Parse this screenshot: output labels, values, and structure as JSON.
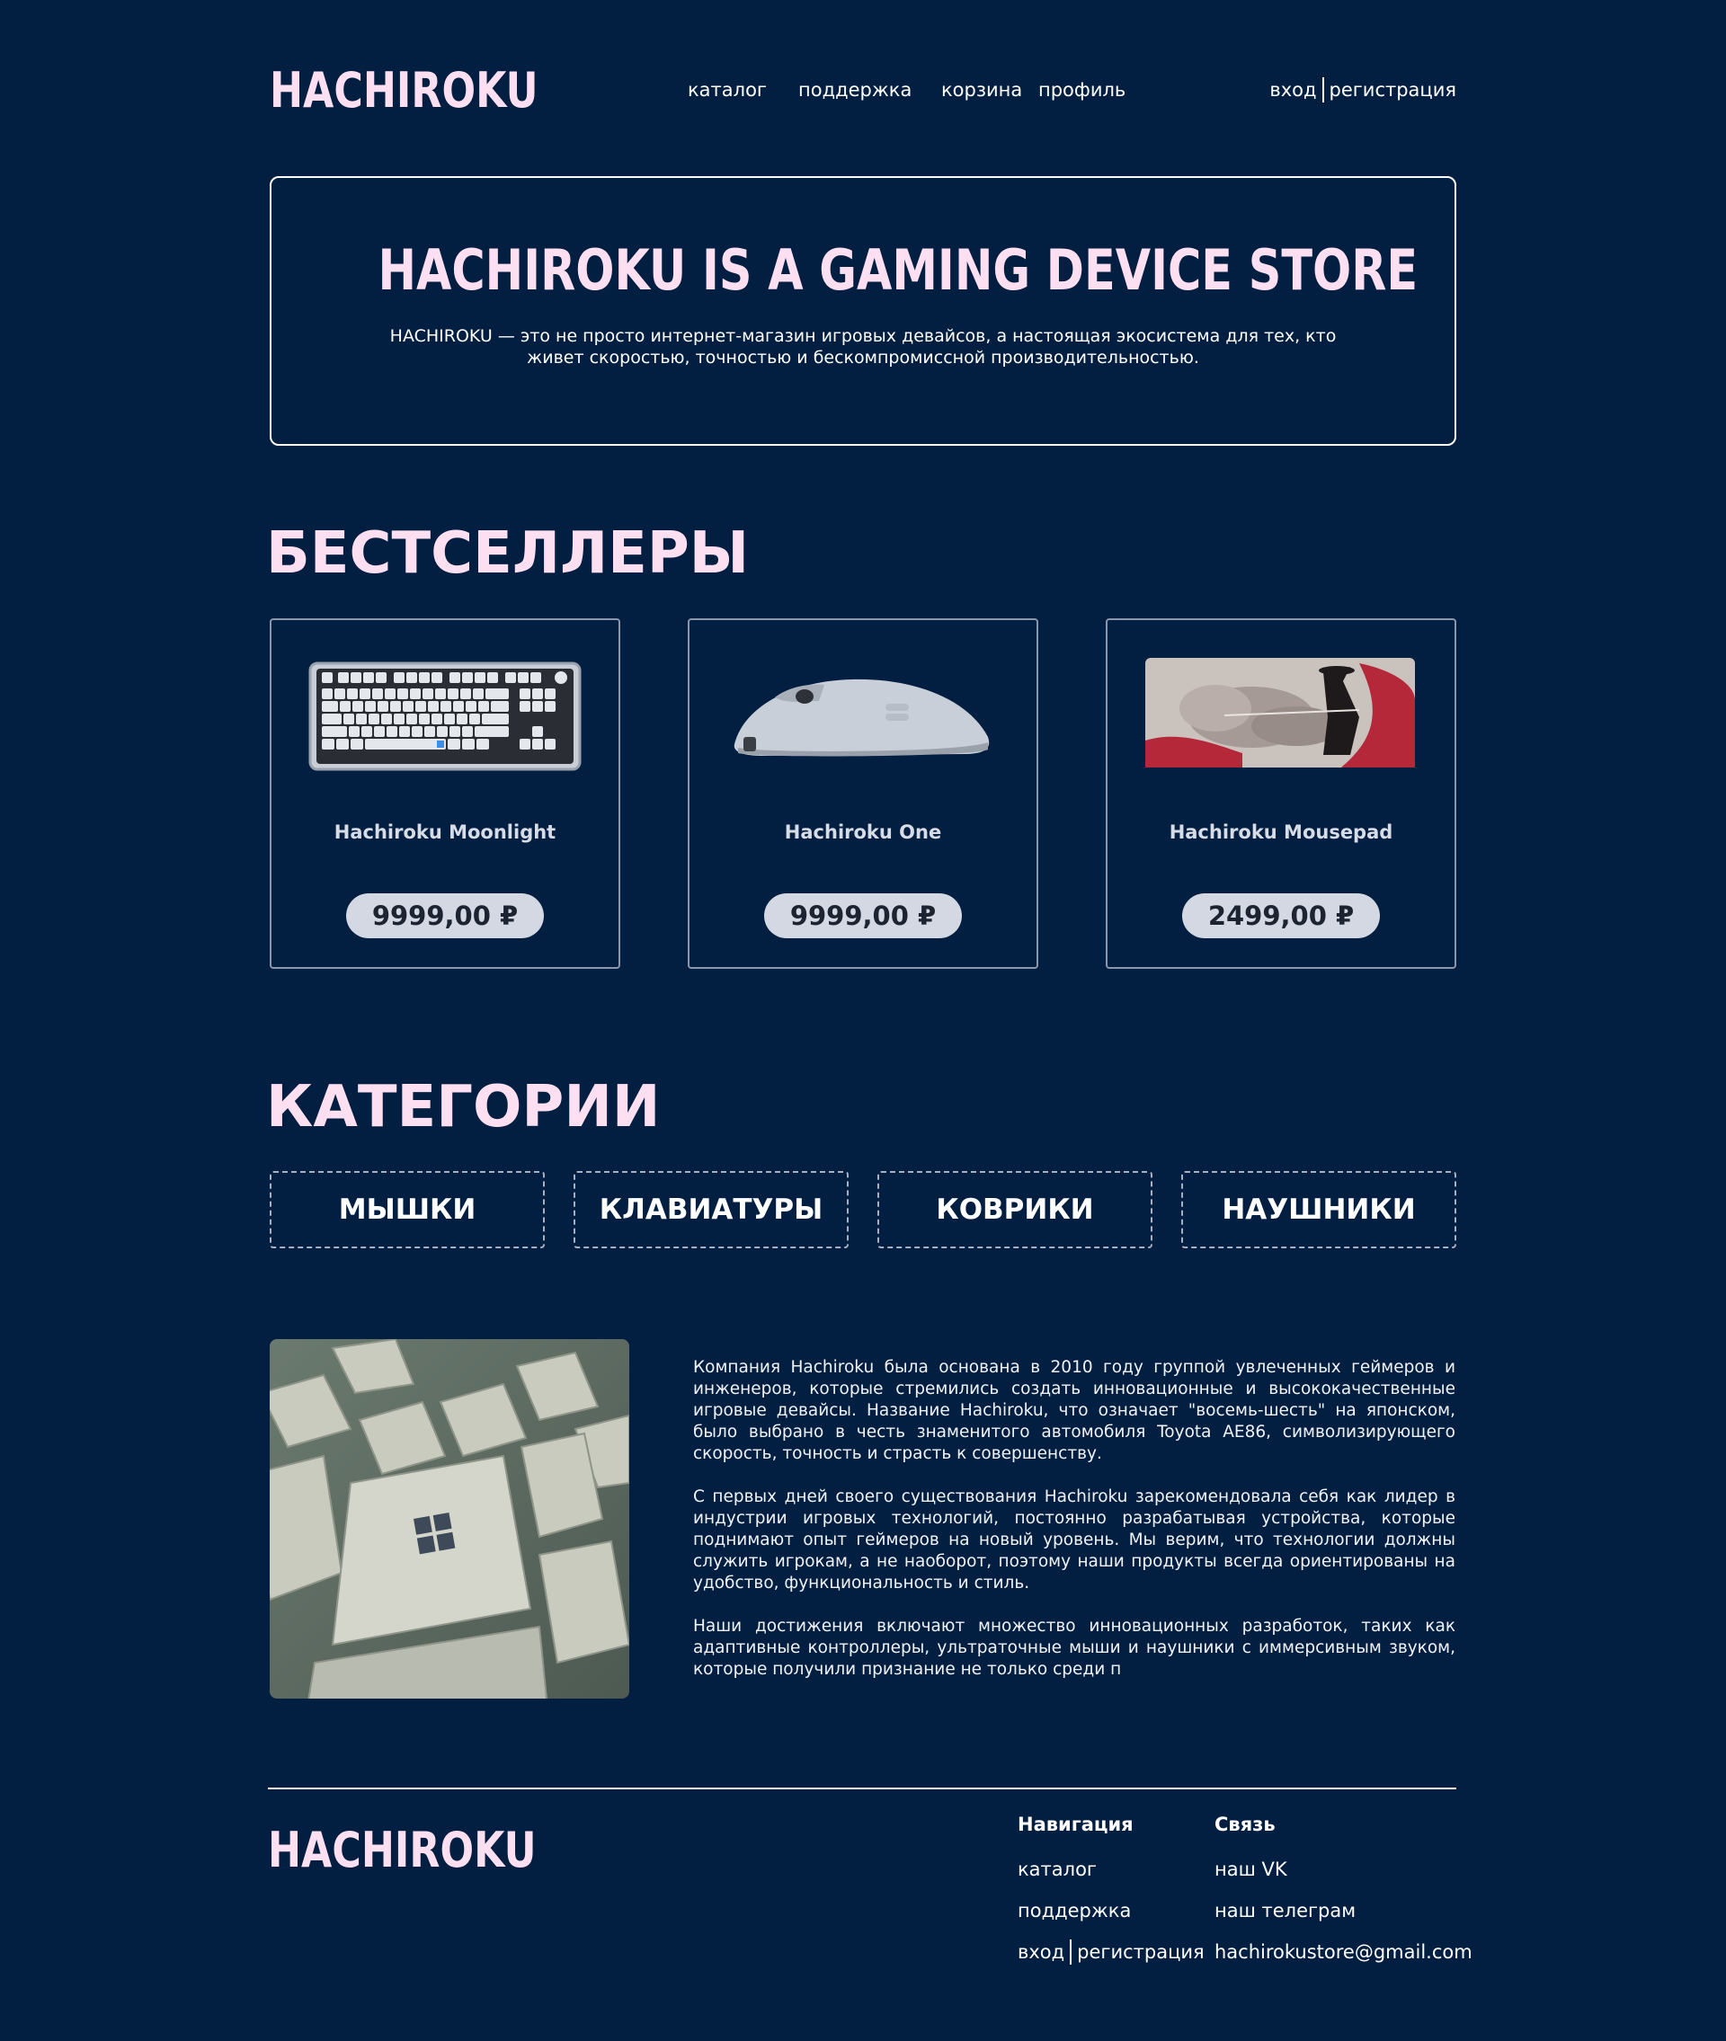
{
  "header": {
    "logo": "HACHIROKU",
    "nav": [
      "каталог",
      "поддержка",
      "корзина",
      "профиль"
    ],
    "login": "вход",
    "register": "регистрация"
  },
  "hero": {
    "title": "HACHIROKU IS A GAMING DEVICE STORE",
    "text": "HACHIROKU — это не просто интернет-магазин игровых девайсов, а настоящая экосистема для тех, кто живет скоростью, точностью и бескомпромиссной производительностью."
  },
  "bestsellers": {
    "title": "БЕСТСЕЛЛЕРЫ",
    "items": [
      {
        "name": "Hachiroku Moonlight",
        "price": "9999,00 ₽",
        "image": "keyboard"
      },
      {
        "name": "Hachiroku One",
        "price": "9999,00 ₽",
        "image": "mouse"
      },
      {
        "name": "Hachiroku Mousepad",
        "price": "2499,00 ₽",
        "image": "mousepad"
      }
    ]
  },
  "categories": {
    "title": "КАТЕГОРИИ",
    "items": [
      "МЫШКИ",
      "КЛАВИАТУРЫ",
      "КОВРИКИ",
      "НАУШНИКИ"
    ]
  },
  "about": {
    "image": "keyboard-keys-photo",
    "paragraphs": [
      "Компания Hachiroku была основана в 2010 году группой увлеченных геймеров и инженеров, которые стремились создать инновационные и высококачественные игровые девайсы. Название Hachiroku, что означает \"восемь-шесть\" на японском, было выбрано в честь знаменитого автомобиля Toyota AE86, символизирующего скорость, точность и страсть к совершенству.",
      "С первых дней своего существования Hachiroku зарекомендовала себя как лидер в индустрии игровых технологий, постоянно разрабатывая устройства, которые поднимают опыт геймеров на новый уровень. Мы верим, что технологии должны служить игрокам, а не наоборот, поэтому наши продукты всегда ориентированы на удобство, функциональность и стиль.",
      "Наши достижения включают множество инновационных разработок, таких как адаптивные контроллеры, ультраточные мыши и наушники с иммерсивным звуком, которые получили признание не только среди п"
    ]
  },
  "footer": {
    "logo": "HACHIROKU",
    "nav_title": "Навигация",
    "nav_links": [
      "каталог",
      "поддержка"
    ],
    "login": "вход",
    "register": "регистрация",
    "contact_title": "Связь",
    "contacts": [
      "наш VK",
      "наш телеграм",
      "hachirokustore@gmail.com"
    ]
  },
  "colors": {
    "background": "#021e41",
    "accent_pink": "#fcdff0",
    "price_pill": "#d3d8e2"
  }
}
